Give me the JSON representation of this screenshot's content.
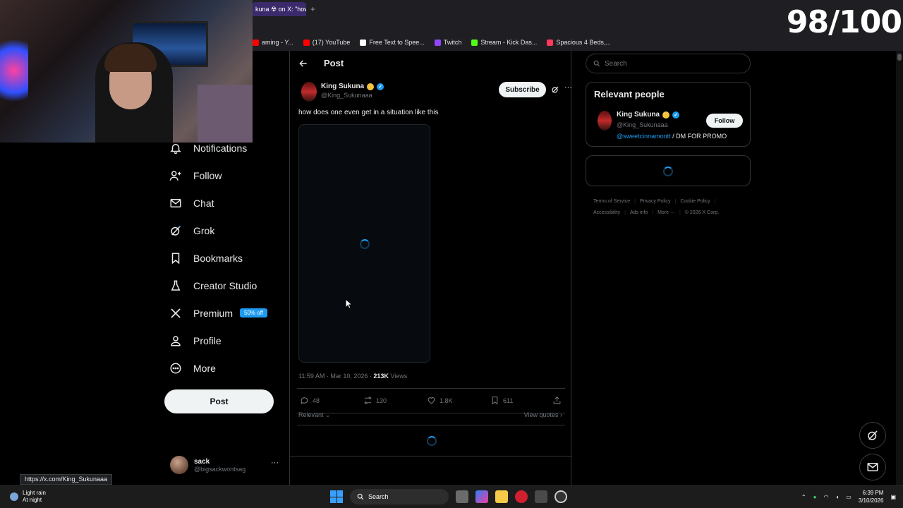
{
  "browser": {
    "active_tab": "kuna ☢ on X: \"how",
    "new_tab": "+",
    "bookmarks": [
      {
        "label": "aming - Y...",
        "color": "#ff0000"
      },
      {
        "label": "(17) YouTube",
        "color": "#ff0000"
      },
      {
        "label": "Free Text to Spee...",
        "color": "#ffffff"
      },
      {
        "label": "Twitch",
        "color": "#9146ff"
      },
      {
        "label": "Stream - Kick Das...",
        "color": "#53fc18"
      },
      {
        "label": "Spacious 4 Beds,...",
        "color": "#ff385c"
      }
    ]
  },
  "overlay": {
    "score": "98/100"
  },
  "nav": {
    "items": [
      {
        "label": "Notifications",
        "icon": "bell-icon"
      },
      {
        "label": "Follow",
        "icon": "person-plus-icon"
      },
      {
        "label": "Chat",
        "icon": "mail-icon"
      },
      {
        "label": "Grok",
        "icon": "grok-icon"
      },
      {
        "label": "Bookmarks",
        "icon": "bookmark-icon"
      },
      {
        "label": "Creator Studio",
        "icon": "flask-icon"
      },
      {
        "label": "Premium",
        "icon": "x-logo-icon",
        "badge": "50% off"
      },
      {
        "label": "Profile",
        "icon": "person-icon"
      },
      {
        "label": "More",
        "icon": "more-circle-icon"
      }
    ],
    "post_button": "Post",
    "account": {
      "name": "sack",
      "handle": "@bigsackwontsag",
      "more": "···"
    }
  },
  "status_url": "https://x.com/King_Sukunaaa",
  "post": {
    "header_title": "Post",
    "author_name": "King Sukuna",
    "author_handle": "@King_Sukunaaa",
    "subscribe_label": "Subscribe",
    "more": "···",
    "text": "how does one even get in a situation like this",
    "time": "11:59 AM · Mar 10, 2026 · ",
    "views_count": "213K",
    "views_label": " Views",
    "replies": "48",
    "reposts": "130",
    "likes": "1.8K",
    "bookmarks": "611",
    "sort_label": "Relevant ⌄",
    "view_quotes": "View quotes ›"
  },
  "sidebar": {
    "search_placeholder": "Search",
    "relevant_title": "Relevant people",
    "person_name": "King Sukuna",
    "person_handle": "@King_Sukunaaa",
    "follow_label": "Follow",
    "bio_link": "@sweetcinnamontt",
    "bio_text": " / DM FOR PROMO",
    "footer": [
      "Terms of Service",
      "Privacy Policy",
      "Cookie Policy",
      "Accessibility",
      "Ads info",
      "More ···",
      "© 2026 X Corp."
    ]
  },
  "taskbar": {
    "weather_line1": "Light rain",
    "weather_line2": "At night",
    "search_label": "Search",
    "time": "6:39 PM",
    "date": "3/10/2026"
  },
  "colors": {
    "accent": "#1d9bf0",
    "background": "#000000"
  }
}
